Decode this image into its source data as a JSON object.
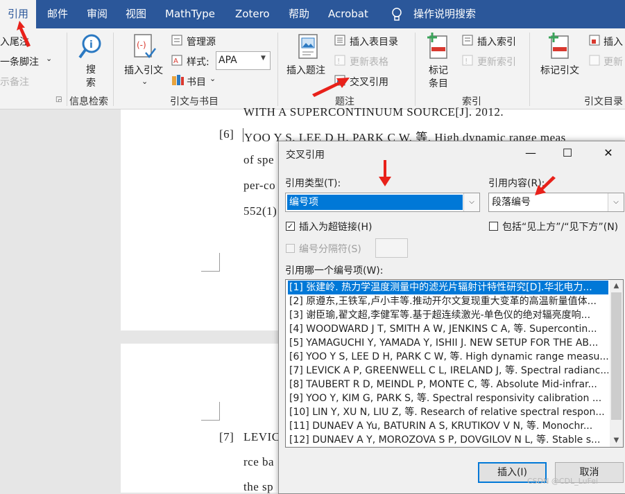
{
  "tabs": [
    {
      "label": "引用",
      "active": true
    },
    {
      "label": "邮件"
    },
    {
      "label": "审阅"
    },
    {
      "label": "视图"
    },
    {
      "label": "MathType"
    },
    {
      "label": "Zotero"
    },
    {
      "label": "帮助"
    },
    {
      "label": "Acrobat"
    }
  ],
  "tell_me": "操作说明搜索",
  "ribbon": {
    "footnotes": {
      "insert_endnote": "入尾注",
      "next_footnote": "一条脚注",
      "show_notes": "示备注"
    },
    "research": {
      "search_line1": "搜",
      "search_line2": "索",
      "group_label": "信息检索"
    },
    "citations": {
      "insert_citation": "插入引文",
      "manage_sources": "管理源",
      "style_label": "样式:",
      "style_value": "APA",
      "bibliography": "书目",
      "group_label": "引文与书目"
    },
    "captions": {
      "insert_caption": "插入题注",
      "insert_table_of_figures": "插入表目录",
      "update_table": "更新表格",
      "cross_reference": "交叉引用",
      "group_label": "题注"
    },
    "index": {
      "mark_entry_line1": "标记",
      "mark_entry_line2": "条目",
      "insert_index": "插入索引",
      "update_index": "更新索引",
      "group_label": "索引"
    },
    "toa": {
      "mark_citation": "标记引文",
      "insert": "插入",
      "update": "更新",
      "group_label": "引文目录"
    }
  },
  "document": {
    "line_top": "WITH  A  SUPERCONTINUUM  SOURCE[J].  2012.",
    "ref6_num": "[6]",
    "ref6_line1": "YOO  Y  S,  LEE  D  H,  PARK  C  W,  等.  High  dynamic  range  meas",
    "ref6_line2": "of  spe",
    "ref6_line3": "per-co",
    "ref6_line4": "552(1)",
    "ref7_num": "[7]",
    "ref7_line1": "LEVIC",
    "ref7_line2": "rce  ba",
    "ref7_line3": "the  sp"
  },
  "dialog": {
    "title": "交叉引用",
    "ref_type_label": "引用类型(T):",
    "ref_type_value": "编号项",
    "ref_content_label": "引用内容(R):",
    "ref_content_value": "段落编号",
    "insert_hyperlink_label": "插入为超链接(H)",
    "insert_hyperlink_checked": true,
    "include_above_below_label": "包括“见上方”/“见下方”(N)",
    "include_above_below_checked": false,
    "separate_numbers_label": "编号分隔符(S)",
    "which_item_label": "引用哪一个编号项(W):",
    "items": [
      "[1] 张建岭. 热力学温度测量中的滤光片辐射计特性研究[D].华北电力...",
      "[2] 原遵东,王铁军,卢小丰等.推动开尔文复现重大变革的高温新量值体...",
      "[3] 谢臣瑜,翟文超,李健军等.基于超连续激光-单色仪的绝对辐亮度响...",
      "[4] WOODWARD J T, SMITH A W, JENKINS C A, 等. Supercontin...",
      "[5] YAMAGUCHI Y, YAMADA Y, ISHII J. NEW SETUP FOR THE AB...",
      "[6] YOO Y S, LEE D H, PARK C W, 等. High dynamic range measu...",
      "[7] LEVICK A P, GREENWELL C L, IRELAND J, 等. Spectral radianc...",
      "[8] TAUBERT R D, MEINDL P, MONTE C, 等. Absolute Mid-infrar...",
      "[9] YOO Y, KIM G, PARK S, 等. Spectral responsivity calibration ...",
      "[10] LIN Y, XU N, LIU Z, 等. Research of relative spectral respon...",
      "[11] DUNAEV A Yu, BATURIN A S, KRUTIKOV V N, 等. Monochr...",
      "[12] DUNAEV A Y, MOROZOVA S P, DOVGILOV N L, 等. Stable s..."
    ],
    "insert_button": "插入(I)",
    "cancel_button": "取消",
    "minimize_glyph": "—",
    "maximize_glyph": "☐",
    "close_glyph": "✕"
  },
  "watermark": "CSDN @CDL_LuFei",
  "colors": {
    "ribbon_blue": "#2b579a",
    "selection_blue": "#0078d7",
    "annotation_red": "#e8211a"
  }
}
